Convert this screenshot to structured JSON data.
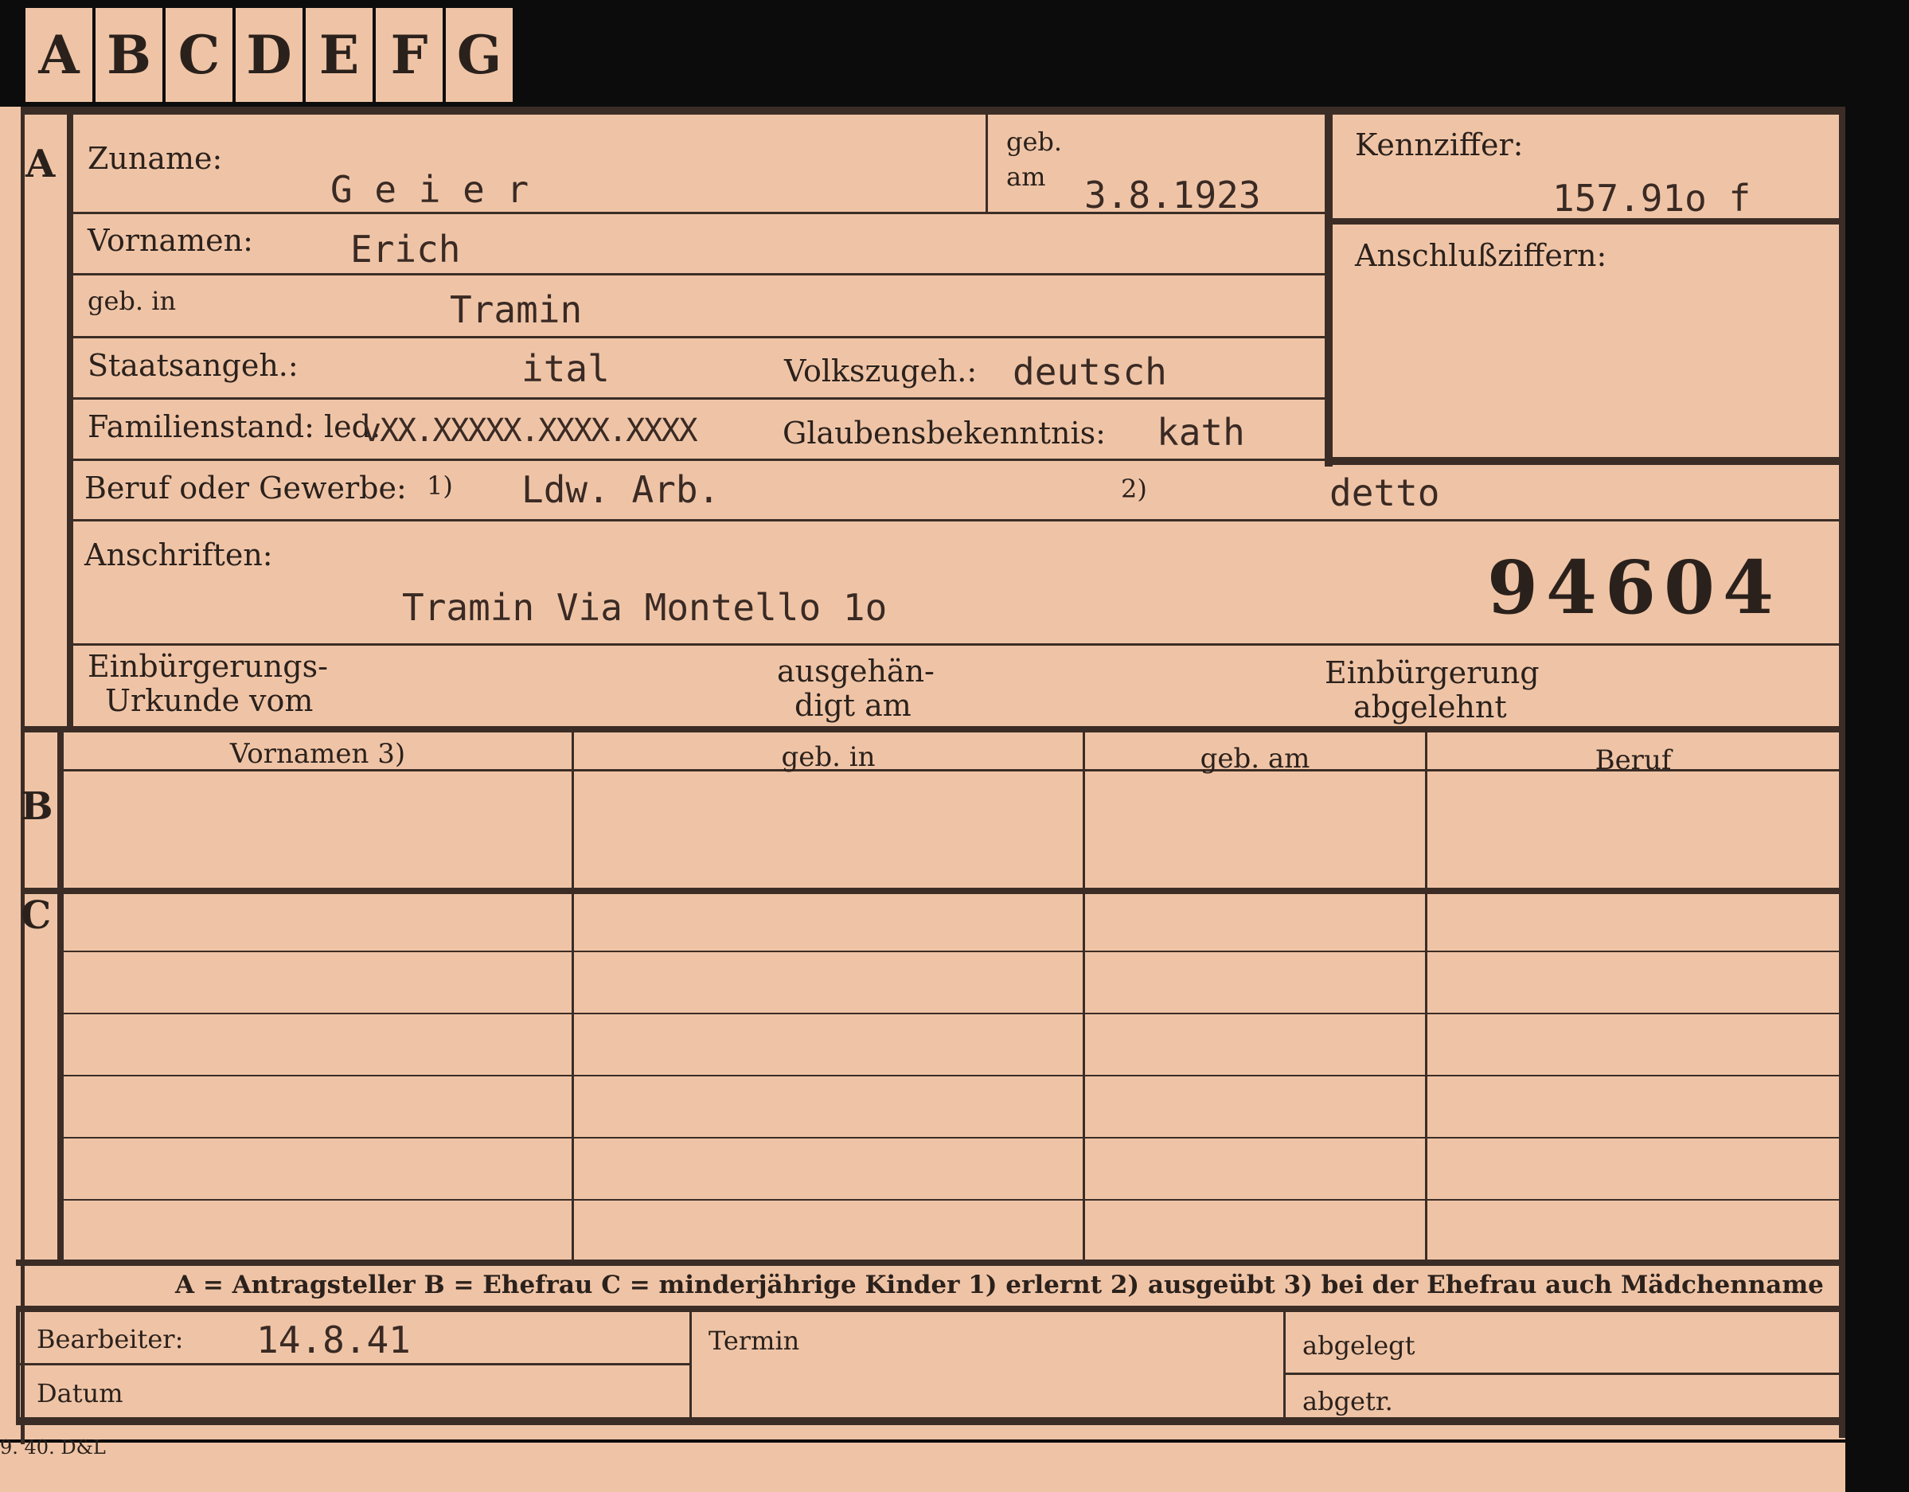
{
  "tabs": [
    "A",
    "B",
    "C",
    "D",
    "E",
    "F",
    "G"
  ],
  "section_labels": {
    "a": "A",
    "b": "B",
    "c": "C"
  },
  "labels": {
    "zuname": "Zuname:",
    "geb_am": "geb.\nam",
    "kennziffer": "Kennziffer:",
    "anschlussziffern": "Anschlußziffern:",
    "vornamen": "Vornamen:",
    "geb_in": "geb. in",
    "staatsangeh": "Staatsangeh.:",
    "volkszugeh": "Volkszugeh.:",
    "familienstand": "Familienstand: led.",
    "glaubensbekenntnis": "Glaubensbekenntnis:",
    "beruf": "Beruf oder Gewerbe:",
    "beruf_note1": "1)",
    "beruf_note2": "2)",
    "anschriften": "Anschriften:",
    "einbuergerungs_urkunde_1": "Einbürgerungs-",
    "einbuergerungs_urkunde_2": "Urkunde vom",
    "ausgehaendigt_1": "ausgehän-",
    "ausgehaendigt_2": "digt am",
    "einbuergerung_abgelehnt_1": "Einbürgerung",
    "einbuergerung_abgelehnt_2": "abgelehnt",
    "bearbeiter": "Bearbeiter:",
    "datum": "Datum",
    "termin": "Termin",
    "abgelegt": "abgelegt",
    "abgetr": "abgetr.",
    "print_code": "9. 40. D&L"
  },
  "values": {
    "zuname": "G e i e r",
    "geb_am": "3.8.1923",
    "kennziffer": "157.91o  f",
    "vornamen": "Erich",
    "geb_in": "Tramin",
    "staatsangeh": "ital",
    "volkszugeh": "deutsch",
    "familienstand_struck": "vXX.XXXXX.XXXX.XXXX",
    "glaubensbekenntnis": "kath",
    "beruf_erlernt": "Ldw. Arb.",
    "beruf_ausgeuebt": "detto",
    "anschrift": "Tramin Via Montello 1o",
    "stamp_number": "94604",
    "bearbeiter_datum": "14.8.41"
  },
  "table_headers": [
    "Vornamen 3)",
    "geb. in",
    "geb. am",
    "Beruf"
  ],
  "legend": "A = Antragsteller   B = Ehefrau   C = minderjährige Kinder   1) erlernt   2) ausgeübt   3) bei der Ehefrau auch Mädchenname",
  "colors": {
    "card": "#efc4a6",
    "ink": "#2b211c",
    "border": "#0c0c0c"
  }
}
